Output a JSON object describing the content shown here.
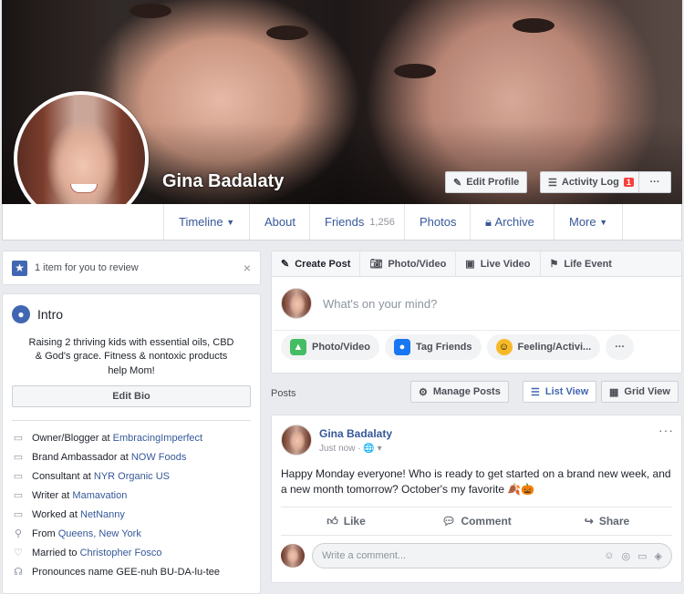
{
  "profile": {
    "name": "Gina Badalaty",
    "edit_profile": "Edit Profile",
    "activity_log": "Activity Log",
    "activity_badge": "1",
    "more_dots": "···"
  },
  "nav": {
    "timeline": "Timeline",
    "about": "About",
    "friends": "Friends",
    "friends_count": "1,256",
    "photos": "Photos",
    "archive": "Archive",
    "more": "More"
  },
  "review": {
    "text": "1 item for you to review",
    "close": "×"
  },
  "intro": {
    "title": "Intro",
    "bio": "Raising 2 thriving kids with essential oils, CBD & God's grace. Fitness & nontoxic products help Mom!",
    "edit_bio": "Edit Bio",
    "rows": [
      {
        "prefix": "Owner/Blogger at ",
        "link": "EmbracingImperfect",
        "icon": "briefcase-icon"
      },
      {
        "prefix": "Brand Ambassador at ",
        "link": "NOW Foods",
        "icon": "briefcase-icon"
      },
      {
        "prefix": "Consultant at ",
        "link": "NYR Organic US",
        "icon": "briefcase-icon"
      },
      {
        "prefix": "Writer at ",
        "link": "Mamavation",
        "icon": "briefcase-icon"
      },
      {
        "prefix": "Worked at ",
        "link": "NetNanny",
        "icon": "briefcase-icon"
      },
      {
        "prefix": "From ",
        "link": "Queens, New York",
        "icon": "location-icon"
      },
      {
        "prefix": "Married to ",
        "link": "Christopher Fosco",
        "icon": "heart-icon"
      },
      {
        "prefix": "Pronounces name GEE-nuh BU-DA-lu-tee",
        "link": "",
        "icon": "speech-icon"
      }
    ]
  },
  "composer": {
    "tabs": [
      "Create Post",
      "Photo/Video",
      "Live Video",
      "Life Event"
    ],
    "placeholder": "What's on your mind?",
    "actions": [
      "Photo/Video",
      "Tag Friends",
      "Feeling/Activi..."
    ],
    "more": "···"
  },
  "posts_bar": {
    "label": "Posts",
    "manage": "Manage Posts",
    "list_view": "List View",
    "grid_view": "Grid View"
  },
  "post": {
    "author": "Gina Badalaty",
    "time": "Just now · 🌐 ▾",
    "text": "Happy Monday everyone! Who is ready to get started on a brand new week, and a new month tomorrow? October's my favorite 🍂🎃",
    "like": "Like",
    "comment": "Comment",
    "share": "Share",
    "comment_placeholder": "Write a comment...",
    "more": "···"
  },
  "colors": {
    "accent": "#4267b2",
    "link": "#365899",
    "badge": "#fa3e3e"
  }
}
